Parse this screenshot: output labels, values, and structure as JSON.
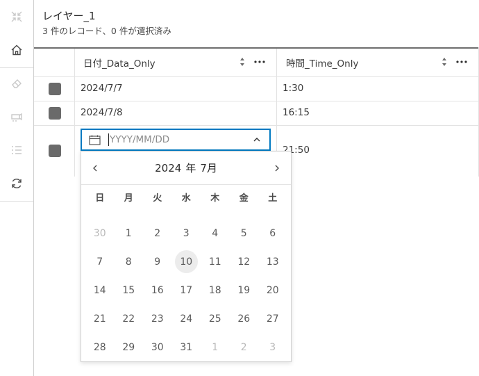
{
  "layer": {
    "title": "レイヤー_1",
    "subtitle": "3 件のレコード、0 件が選択済み"
  },
  "toolbar": {
    "items": [
      {
        "icon": "collapse-icon",
        "enabled": false
      },
      {
        "icon": "home-icon",
        "enabled": true
      },
      {
        "icon": "eraser-icon",
        "enabled": false
      },
      {
        "icon": "highlight-icon",
        "enabled": false
      },
      {
        "icon": "list-icon",
        "enabled": false
      },
      {
        "icon": "refresh-icon",
        "enabled": true
      }
    ]
  },
  "table": {
    "columns": [
      "日付_Data_Only",
      "時間_Time_Only"
    ],
    "rows": [
      {
        "date": "2024/7/7",
        "time": "1:30"
      },
      {
        "date": "2024/7/8",
        "time": "16:15"
      },
      {
        "date": "",
        "time": "21:50"
      }
    ]
  },
  "date_input": {
    "placeholder": "YYYY/MM/DD"
  },
  "calendar": {
    "year": "2024",
    "year_suffix": "年",
    "month": "7月",
    "weekdays": [
      "日",
      "月",
      "火",
      "水",
      "木",
      "金",
      "土"
    ],
    "days": [
      {
        "d": "30",
        "other": true
      },
      {
        "d": "1"
      },
      {
        "d": "2"
      },
      {
        "d": "3"
      },
      {
        "d": "4"
      },
      {
        "d": "5"
      },
      {
        "d": "6"
      },
      {
        "d": "7"
      },
      {
        "d": "8"
      },
      {
        "d": "9"
      },
      {
        "d": "10",
        "today": true
      },
      {
        "d": "11"
      },
      {
        "d": "12"
      },
      {
        "d": "13"
      },
      {
        "d": "14"
      },
      {
        "d": "15"
      },
      {
        "d": "16"
      },
      {
        "d": "17"
      },
      {
        "d": "18"
      },
      {
        "d": "19"
      },
      {
        "d": "20"
      },
      {
        "d": "21"
      },
      {
        "d": "22"
      },
      {
        "d": "23"
      },
      {
        "d": "24"
      },
      {
        "d": "25"
      },
      {
        "d": "26"
      },
      {
        "d": "27"
      },
      {
        "d": "28"
      },
      {
        "d": "29"
      },
      {
        "d": "30"
      },
      {
        "d": "31"
      },
      {
        "d": "1",
        "other": true
      },
      {
        "d": "2",
        "other": true
      },
      {
        "d": "3",
        "other": true
      }
    ]
  },
  "colors": {
    "accent": "#0079c1",
    "row_marker": "#6a6a6a",
    "today_bg": "#ececec"
  }
}
